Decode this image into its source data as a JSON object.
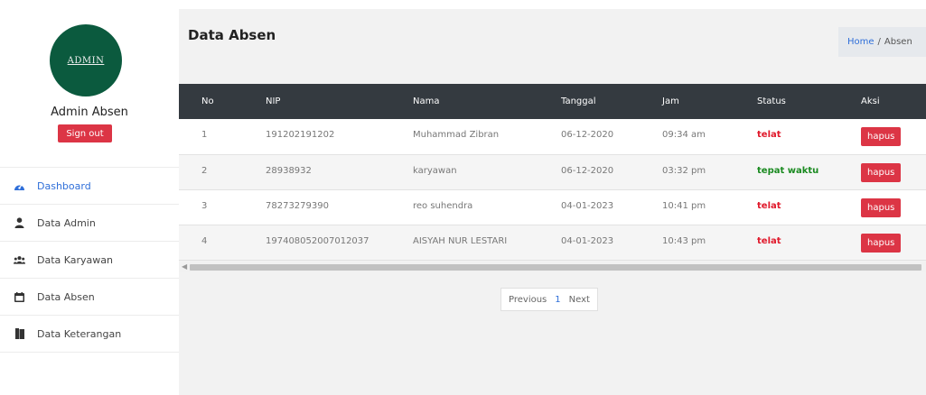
{
  "sidebar": {
    "avatar_text": "ADMIN",
    "user_name": "Admin Absen",
    "signout_label": "Sign out",
    "items": [
      {
        "label": "Dashboard",
        "icon": "dashboard-icon",
        "active": true
      },
      {
        "label": "Data Admin",
        "icon": "user-icon"
      },
      {
        "label": "Data Karyawan",
        "icon": "users-icon"
      },
      {
        "label": "Data Absen",
        "icon": "calendar-icon"
      },
      {
        "label": "Data Keterangan",
        "icon": "book-icon"
      }
    ]
  },
  "header": {
    "title": "Data Absen",
    "breadcrumb": {
      "home": "Home",
      "separator": "/",
      "current": "Absen"
    }
  },
  "table": {
    "columns": [
      "No",
      "NIP",
      "Nama",
      "Tanggal",
      "Jam",
      "Status",
      "Aksi"
    ],
    "rows": [
      {
        "no": "1",
        "nip": "191202191202",
        "nama": "Muhammad Zibran",
        "tanggal": "06-12-2020",
        "jam": "09:34 am",
        "status": "telat",
        "aksi": "hapus"
      },
      {
        "no": "2",
        "nip": "28938932",
        "nama": "karyawan",
        "tanggal": "06-12-2020",
        "jam": "03:32 pm",
        "status": "tepat waktu",
        "aksi": "hapus"
      },
      {
        "no": "3",
        "nip": "78273279390",
        "nama": "reo suhendra",
        "tanggal": "04-01-2023",
        "jam": "10:41 pm",
        "status": "telat",
        "aksi": "hapus"
      },
      {
        "no": "4",
        "nip": "197408052007012037",
        "nama": "AISYAH NUR LESTARI",
        "tanggal": "04-01-2023",
        "jam": "10:43 pm",
        "status": "telat",
        "aksi": "hapus"
      }
    ]
  },
  "pagination": {
    "previous": "Previous",
    "current_page": "1",
    "next": "Next"
  },
  "colors": {
    "accent": "#dc3545",
    "avatar_bg": "#0b5a3e",
    "header_bg": "#343a40",
    "link": "#2f6fd9",
    "late": "#e0192b",
    "on_time": "#1a8a20"
  }
}
